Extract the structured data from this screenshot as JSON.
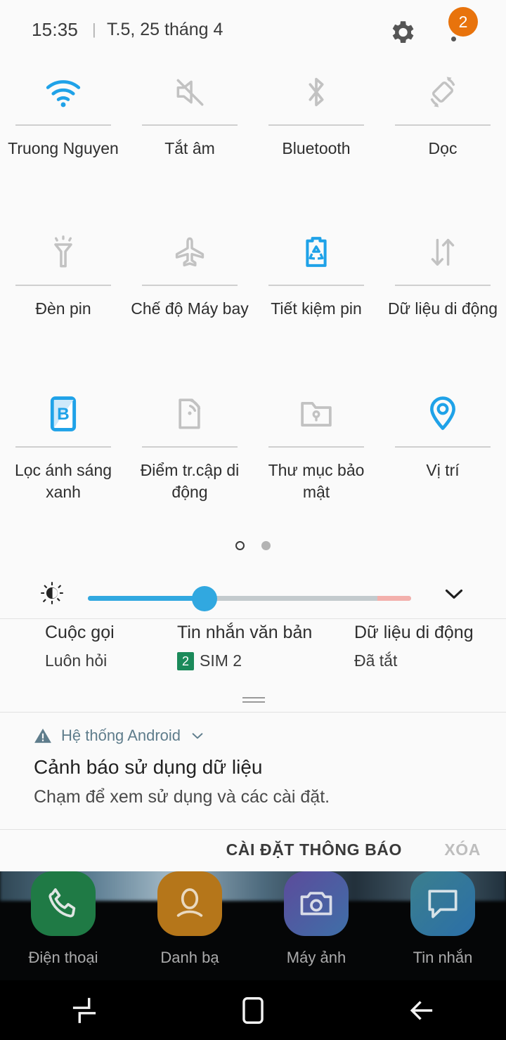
{
  "statusbar": {
    "time": "15:35",
    "separator": "|",
    "date": "T.5, 25 tháng 4",
    "settings_icon": "gear-icon",
    "menu_icon": "overflow-menu-icon",
    "badge_count": "2",
    "badge_color": "#e8730c"
  },
  "colors": {
    "active": "#31a8e0",
    "inactive": "#bdbdbd",
    "panel_bg": "#fafafa",
    "sim_green": "#1b8a5a",
    "notif_app": "#5f7d8c"
  },
  "tiles": [
    [
      {
        "label": "Truong Nguyen",
        "icon": "wifi-icon",
        "active": true
      },
      {
        "label": "Tắt âm",
        "icon": "mute-icon",
        "active": false
      },
      {
        "label": "Bluetooth",
        "icon": "bluetooth-icon",
        "active": false
      },
      {
        "label": "Dọc",
        "icon": "rotation-portrait-icon",
        "active": false
      }
    ],
    [
      {
        "label": "Đèn pin",
        "icon": "flashlight-icon",
        "active": false
      },
      {
        "label": "Chế độ Máy bay",
        "icon": "airplane-icon",
        "active": false
      },
      {
        "label": "Tiết kiệm pin",
        "icon": "battery-saver-icon",
        "active": true
      },
      {
        "label": "Dữ liệu di động",
        "icon": "mobile-data-icon",
        "active": false
      }
    ],
    [
      {
        "label": "Lọc ánh sáng xanh",
        "icon": "blue-light-filter-icon",
        "active": true
      },
      {
        "label": "Điểm tr.cập di động",
        "icon": "mobile-hotspot-icon",
        "active": false
      },
      {
        "label": "Thư mục bảo mật",
        "icon": "secure-folder-icon",
        "active": false
      },
      {
        "label": "Vị trí",
        "icon": "location-pin-icon",
        "active": true
      }
    ]
  ],
  "pager": {
    "pages": 2,
    "current": 1
  },
  "brightness": {
    "icon": "brightness-icon",
    "value_percent": 36,
    "warn_zone_percent": 10.5,
    "expand_icon": "chevron-down-icon"
  },
  "sim_manager": [
    {
      "title": "Cuộc gọi",
      "value": "Luôn hỏi",
      "chip": ""
    },
    {
      "title": "Tin nhắn văn bản",
      "value": "SIM 2",
      "chip": "2"
    },
    {
      "title": "Dữ liệu di động",
      "value": "Đã tắt",
      "chip": ""
    }
  ],
  "notification": {
    "app_icon": "warning-triangle-icon",
    "app_name": "Hệ thống Android",
    "expand_icon": "chevron-down-icon",
    "title": "Cảnh báo sử dụng dữ liệu",
    "body": "Chạm để xem sử dụng và các cài đặt."
  },
  "notification_actions": {
    "settings": "CÀI ĐẶT THÔNG BÁO",
    "clear": "XÓA"
  },
  "dock": [
    {
      "label": "Điện thoại",
      "icon": "phone-icon",
      "color": "#1f7a45"
    },
    {
      "label": "Danh bạ",
      "icon": "contacts-icon",
      "color": "#b5761a"
    },
    {
      "label": "Máy ảnh",
      "icon": "camera-icon",
      "color": "#4b4a8e"
    },
    {
      "label": "Tin nhắn",
      "icon": "messages-icon",
      "color": "#2b7f9c"
    }
  ],
  "navbar": [
    {
      "name": "recents",
      "icon": "recents-icon"
    },
    {
      "name": "home",
      "icon": "home-icon"
    },
    {
      "name": "back",
      "icon": "back-icon"
    }
  ]
}
